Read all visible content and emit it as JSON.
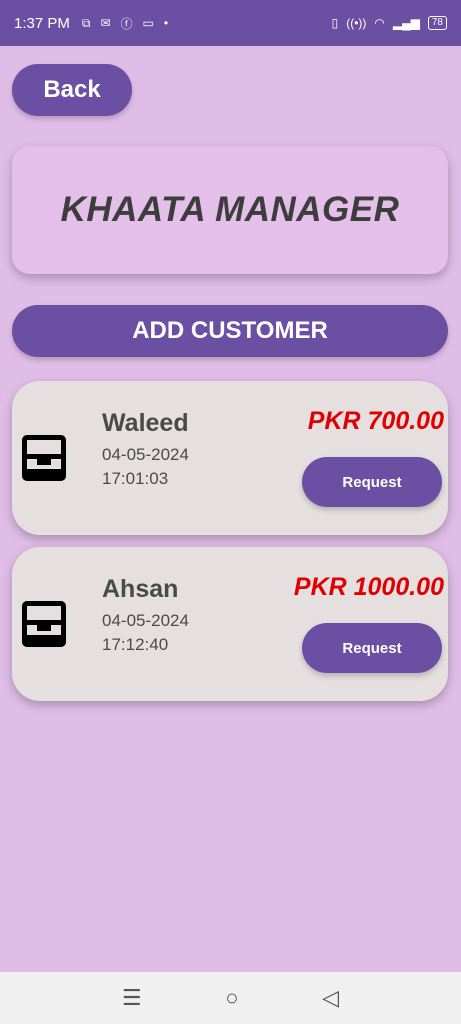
{
  "status_bar": {
    "time": "1:37 PM",
    "battery": "78"
  },
  "back_label": "Back",
  "app_title": "KHAATA MANAGER",
  "add_customer_label": "ADD CUSTOMER",
  "customers": [
    {
      "name": "Waleed",
      "date": "04-05-2024",
      "time": "17:01:03",
      "amount": "PKR 700.00",
      "action_label": "Request"
    },
    {
      "name": "Ahsan",
      "date": "04-05-2024",
      "time": "17:12:40",
      "amount": "PKR 1000.00",
      "action_label": "Request"
    }
  ],
  "colors": {
    "background": "#e0bde7",
    "primary": "#6a4fa3",
    "card": "#e5dfdf",
    "amount": "#e00000"
  }
}
